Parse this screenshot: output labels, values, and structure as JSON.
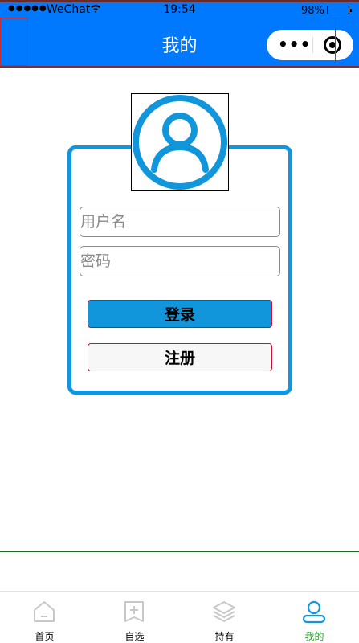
{
  "status_bar": {
    "signal": "●●●●●",
    "carrier": "WeChat",
    "time": "19:54",
    "battery": "98%",
    "battery_level": 0.98
  },
  "nav": {
    "title": "我的",
    "more_glyph": "•••"
  },
  "login_form": {
    "username_placeholder": "用户名",
    "password_placeholder": "密码",
    "login_label": "登录",
    "register_label": "注册"
  },
  "tabbar": {
    "items": [
      {
        "label": "首页",
        "icon": "home-icon",
        "active": false
      },
      {
        "label": "自选",
        "icon": "add-square-icon",
        "active": false
      },
      {
        "label": "持有",
        "icon": "layers-icon",
        "active": false
      },
      {
        "label": "我的",
        "icon": "user-icon",
        "active": true
      }
    ]
  },
  "colors": {
    "nav_bg": "#0079fe",
    "accent": "#1296db",
    "active_tab": "#2aa02a"
  }
}
